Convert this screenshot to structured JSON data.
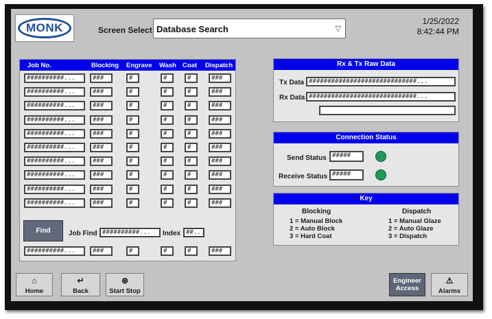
{
  "header": {
    "logo_text": "MONK",
    "screen_select_label": "Screen Select",
    "screen_select_value": "Database Search",
    "date": "1/25/2022",
    "time": "8:42:44 PM"
  },
  "jobs_table": {
    "headers": [
      "Job No.",
      "Blocking",
      "Engrave",
      "Wash",
      "Coat",
      "Dispatch"
    ],
    "row_values": [
      "##########...",
      "###",
      "#",
      "#",
      "#",
      "###"
    ],
    "row_count": 10
  },
  "find": {
    "button_label": "Find",
    "job_find_label": "Job Find",
    "job_find_value": "##########...",
    "index_label": "Index",
    "index_value": "##...",
    "result_values": [
      "##########...",
      "###",
      "#",
      "#",
      "#",
      "###"
    ]
  },
  "raw_data": {
    "title": "Rx & Tx Raw Data",
    "tx_label": "Tx Data",
    "tx_value": "#############################...",
    "rx_label": "Rx Data",
    "rx_value": "#############################...",
    "extra_value": ""
  },
  "connection": {
    "title": "Connection Status",
    "send_label": "Send Status",
    "send_value": "#####",
    "receive_label": "Receive Status",
    "receive_value": "#####",
    "indicator_color": "#1f9a57"
  },
  "key": {
    "title": "Key",
    "blocking_title": "Blocking",
    "blocking_items": [
      "1 = Manual Block",
      "2 = Auto Block",
      "3 = Hard Coat"
    ],
    "dispatch_title": "Dispatch",
    "dispatch_items": [
      "1 = Manual Glaze",
      "2 = Auto Glaze",
      "3 = Dispatch"
    ]
  },
  "nav": {
    "home": "Home",
    "back": "Back",
    "start_stop": "Start Stop",
    "engineer_line1": "Engineer",
    "engineer_line2": "Access",
    "alarms": "Alarms",
    "icons": {
      "home": "home-icon",
      "back": "back-arrow-icon",
      "start_stop": "start-stop-icon",
      "alarms": "warning-icon"
    }
  },
  "colors": {
    "header_blue": "#0000ee",
    "logo_blue": "#1f4e99",
    "panel_bg": "#e6e6e6",
    "screen_bg": "#c3c3c3"
  }
}
